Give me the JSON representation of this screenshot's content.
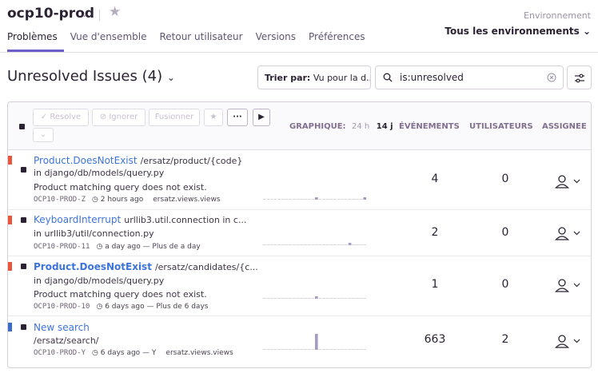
{
  "header": {
    "project": "ocp10-prod",
    "tabs": [
      "Problèmes",
      "Vue d'ensemble",
      "Retour utilisateur",
      "Versions",
      "Préférences"
    ],
    "env_label": "Environnement",
    "env_value": "Tous les environnements"
  },
  "toolbar": {
    "title": "Unresolved Issues",
    "count": "(4)",
    "sort_label": "Trier par:",
    "sort_value": "Vu pour la d...",
    "search_value": "is:unresolved"
  },
  "actions": {
    "resolve": "Resolve",
    "ignore": "Ignorer",
    "merge": "Fusionner"
  },
  "columns": {
    "graph": "GRAPHIQUE:",
    "h24": "24 h",
    "d14": "14 j",
    "events": "ÉVÉNEMENTS",
    "users": "UTILISATEURS",
    "assignee": "ASSIGNEE"
  },
  "colors": {
    "error": "#e8563c",
    "info": "#3b6ecc",
    "link": "#3d74db",
    "accent": "#6c5fc7"
  },
  "issues": [
    {
      "title": "Product.DoesNotExist",
      "location": "/ersatz/product/{code}",
      "line2": "in django/db/models/query.py",
      "line3": "Product matching query does not exist.",
      "code": "OCP10-PROD-Z",
      "age": "2 hours ago",
      "extra": "ersatz.views.views",
      "events": "4",
      "users": "0",
      "level": "error",
      "spark": [
        0,
        0,
        0,
        0,
        0,
        0,
        0,
        0,
        0,
        0,
        0,
        0,
        0,
        0,
        1,
        0,
        0,
        0,
        0,
        0,
        0,
        0,
        0,
        0,
        0,
        0,
        0,
        1
      ]
    },
    {
      "title": "KeyboardInterrupt",
      "location": "urllib3.util.connection in c...",
      "line2": "in urllib3/util/connection.py",
      "line3": "",
      "code": "OCP10-PROD-11",
      "age": "a day ago — Plus de a day",
      "extra": "",
      "events": "2",
      "users": "0",
      "level": "error",
      "spark": [
        0,
        0,
        0,
        0,
        0,
        0,
        0,
        0,
        0,
        0,
        0,
        0,
        0,
        0,
        0,
        0,
        0,
        0,
        0,
        0,
        0,
        0,
        0,
        1,
        0,
        0,
        0,
        0
      ]
    },
    {
      "title": "Product.DoesNotExist",
      "location": "/ersatz/candidates/{c...",
      "line2": "in django/db/models/query.py",
      "line3": "Product matching query does not exist.",
      "code": "OCP10-PROD-10",
      "age": "6 days ago — Plus de 6 days",
      "extra": "",
      "events": "1",
      "users": "0",
      "level": "error",
      "spark": [
        0,
        0,
        0,
        0,
        0,
        0,
        0,
        0,
        0,
        0,
        0,
        0,
        0,
        0,
        1,
        0,
        0,
        0,
        0,
        0,
        0,
        0,
        0,
        0,
        0,
        0,
        0,
        0
      ]
    },
    {
      "title": "New search",
      "location": "",
      "line2": "/ersatz/search/",
      "line3": "",
      "code": "OCP10-PROD-Y",
      "age": "6 days ago — Y",
      "extra": "ersatz.views.views",
      "events": "663",
      "users": "2",
      "level": "info",
      "spark": [
        0,
        0,
        0,
        0,
        0,
        0,
        0,
        0,
        0,
        0,
        0,
        0,
        0,
        0,
        9,
        0,
        0,
        0,
        0,
        0,
        0,
        0,
        0,
        0,
        0,
        0,
        0,
        0
      ]
    }
  ]
}
